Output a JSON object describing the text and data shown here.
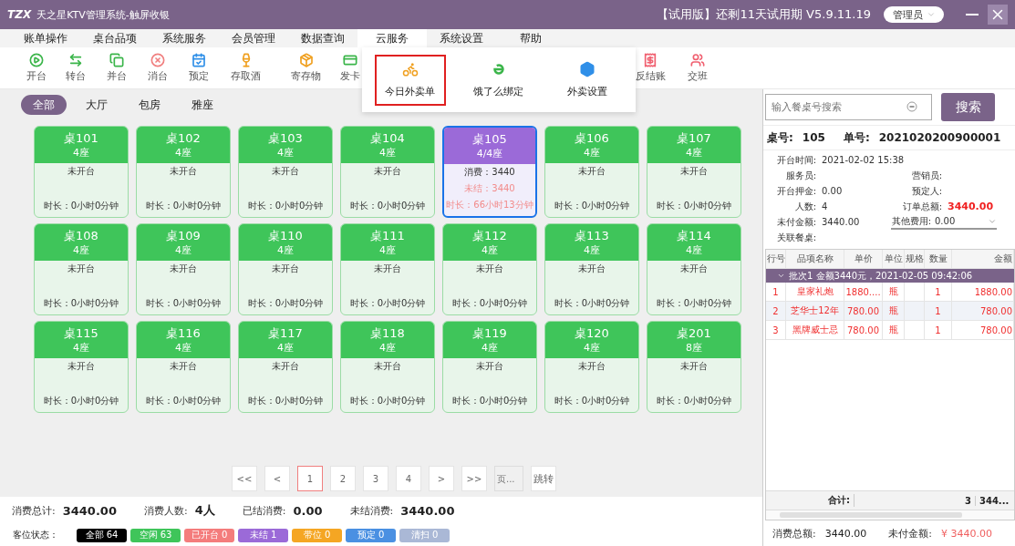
{
  "title_bar": {
    "logo": "TZX",
    "title": "天之星KTV管理系统-触屏收银",
    "trial_info": "【试用版】还剩11天试用期 V5.9.11.19",
    "user": "管理员"
  },
  "menu": [
    {
      "label": "账单操作",
      "selected": false
    },
    {
      "label": "桌台品项",
      "selected": false
    },
    {
      "label": "系统服务",
      "selected": false
    },
    {
      "label": "会员管理",
      "selected": false
    },
    {
      "label": "数据查询",
      "selected": false
    },
    {
      "label": "云服务",
      "selected": true
    },
    {
      "label": "系统设置",
      "selected": false
    },
    {
      "label": "帮助",
      "selected": false
    }
  ],
  "toolbar": [
    {
      "label": "开台",
      "color": "#3bb54a"
    },
    {
      "label": "转台",
      "color": "#3bb54a"
    },
    {
      "label": "并台",
      "color": "#3bb54a"
    },
    {
      "label": "消台",
      "color": "#f07f7f"
    },
    {
      "label": "预定",
      "color": "#2f8fe8"
    },
    {
      "label": "存取酒",
      "color": "#f0a020"
    },
    {
      "label": "寄存物",
      "color": "#f0a020"
    },
    {
      "label": "发卡",
      "color": "#3bb54a"
    },
    {
      "label": "反结账",
      "color": "#f06070"
    },
    {
      "label": "交班",
      "color": "#f06070"
    }
  ],
  "dropdown": [
    {
      "label": "今日外卖单",
      "selected": true
    },
    {
      "label": "饿了么绑定",
      "selected": false
    },
    {
      "label": "外卖设置",
      "selected": false
    }
  ],
  "area_tabs": [
    {
      "label": "全部",
      "selected": true
    },
    {
      "label": "大厅",
      "selected": false
    },
    {
      "label": "包房",
      "selected": false
    },
    {
      "label": "雅座",
      "selected": false
    }
  ],
  "tables": [
    {
      "name": "桌101",
      "seats": "4座",
      "kind": "idle",
      "selected": false,
      "status": "未开台",
      "duration": "时长：0小时0分钟"
    },
    {
      "name": "桌102",
      "seats": "4座",
      "kind": "idle",
      "selected": false,
      "status": "未开台",
      "duration": "时长：0小时0分钟"
    },
    {
      "name": "桌103",
      "seats": "4座",
      "kind": "idle",
      "selected": false,
      "status": "未开台",
      "duration": "时长：0小时0分钟"
    },
    {
      "name": "桌104",
      "seats": "4座",
      "kind": "idle",
      "selected": false,
      "status": "未开台",
      "duration": "时长：0小时0分钟"
    },
    {
      "name": "桌105",
      "seats": "4/4座",
      "kind": "unsettled",
      "selected": true,
      "status": "消费：3440",
      "unsettled": "未结：3440",
      "duration": "时长：66小时13分钟"
    },
    {
      "name": "桌106",
      "seats": "4座",
      "kind": "idle",
      "selected": false,
      "status": "未开台",
      "duration": "时长：0小时0分钟"
    },
    {
      "name": "桌107",
      "seats": "4座",
      "kind": "idle",
      "selected": false,
      "status": "未开台",
      "duration": "时长：0小时0分钟"
    },
    {
      "name": "桌108",
      "seats": "4座",
      "kind": "idle",
      "selected": false,
      "status": "未开台",
      "duration": "时长：0小时0分钟"
    },
    {
      "name": "桌109",
      "seats": "4座",
      "kind": "idle",
      "selected": false,
      "status": "未开台",
      "duration": "时长：0小时0分钟"
    },
    {
      "name": "桌110",
      "seats": "4座",
      "kind": "idle",
      "selected": false,
      "status": "未开台",
      "duration": "时长：0小时0分钟"
    },
    {
      "name": "桌111",
      "seats": "4座",
      "kind": "idle",
      "selected": false,
      "status": "未开台",
      "duration": "时长：0小时0分钟"
    },
    {
      "name": "桌112",
      "seats": "4座",
      "kind": "idle",
      "selected": false,
      "status": "未开台",
      "duration": "时长：0小时0分钟"
    },
    {
      "name": "桌113",
      "seats": "4座",
      "kind": "idle",
      "selected": false,
      "status": "未开台",
      "duration": "时长：0小时0分钟"
    },
    {
      "name": "桌114",
      "seats": "4座",
      "kind": "idle",
      "selected": false,
      "status": "未开台",
      "duration": "时长：0小时0分钟"
    },
    {
      "name": "桌115",
      "seats": "4座",
      "kind": "idle",
      "selected": false,
      "status": "未开台",
      "duration": "时长：0小时0分钟"
    },
    {
      "name": "桌116",
      "seats": "4座",
      "kind": "idle",
      "selected": false,
      "status": "未开台",
      "duration": "时长：0小时0分钟"
    },
    {
      "name": "桌117",
      "seats": "4座",
      "kind": "idle",
      "selected": false,
      "status": "未开台",
      "duration": "时长：0小时0分钟"
    },
    {
      "name": "桌118",
      "seats": "4座",
      "kind": "idle",
      "selected": false,
      "status": "未开台",
      "duration": "时长：0小时0分钟"
    },
    {
      "name": "桌119",
      "seats": "4座",
      "kind": "idle",
      "selected": false,
      "status": "未开台",
      "duration": "时长：0小时0分钟"
    },
    {
      "name": "桌120",
      "seats": "4座",
      "kind": "idle",
      "selected": false,
      "status": "未开台",
      "duration": "时长：0小时0分钟"
    },
    {
      "name": "桌201",
      "seats": "8座",
      "kind": "idle",
      "selected": false,
      "status": "未开台",
      "duration": "时长：0小时0分钟"
    }
  ],
  "pagination": {
    "pages": [
      {
        "label": "<<",
        "selected": false
      },
      {
        "label": "<",
        "selected": false
      },
      {
        "label": "1",
        "selected": true
      },
      {
        "label": "2",
        "selected": false
      },
      {
        "label": "3",
        "selected": false
      },
      {
        "label": "4",
        "selected": false
      },
      {
        "label": ">",
        "selected": false
      },
      {
        "label": ">>",
        "selected": false
      }
    ],
    "page_placeholder": "页...",
    "jump": "跳转"
  },
  "stats": [
    {
      "label": "消费总计:",
      "value": "3440.00"
    },
    {
      "label": "消费人数:",
      "value": "4人"
    },
    {
      "label": "已结消费:",
      "value": "0.00"
    },
    {
      "label": "未结消费:",
      "value": "3440.00"
    }
  ],
  "legend": {
    "label": "客位状态：",
    "chips": [
      {
        "label": "全部 64",
        "color": "#000000"
      },
      {
        "label": "空闲 63",
        "color": "#3fc55a"
      },
      {
        "label": "已开台 0",
        "color": "#f47c7c"
      },
      {
        "label": "未结 1",
        "color": "#9b6ad8"
      },
      {
        "label": "带位 0",
        "color": "#f5a623"
      },
      {
        "label": "预定 0",
        "color": "#4a90e2"
      },
      {
        "label": "清扫 0",
        "color": "#aab8d6"
      }
    ]
  },
  "order": {
    "search_placeholder": "输入餐桌号搜索",
    "search_button": "搜索",
    "table_label": "桌号:",
    "table_no": "105",
    "order_label": "单号:",
    "order_no": "2021020200900001",
    "fields": [
      {
        "label": "开台时间:",
        "value": "2021-02-02 15:38"
      },
      {
        "label": "服务员:"
      },
      {
        "label": "营销员:"
      },
      {
        "label": "开台押金:",
        "value": "0.00"
      },
      {
        "label": "预定人:"
      },
      {
        "label": "人数:",
        "value": "4"
      },
      {
        "label": "订单总额:",
        "value": "3440.00"
      },
      {
        "label": "未付金额:",
        "value": "3440.00"
      },
      {
        "label": "其他费用:",
        "value": "0.00"
      },
      {
        "label": "关联餐桌:"
      }
    ],
    "columns": [
      "行号",
      "品项名称",
      "单价",
      "单位",
      "规格",
      "数量",
      "金额"
    ],
    "batch": "批次1   金额3440元，2021-02-05 09:42:06",
    "rows": [
      [
        "1",
        "皇家礼炮",
        "1880....",
        "瓶",
        "",
        "1",
        "1880.00"
      ],
      [
        "2",
        "芝华士12年",
        "780.00",
        "瓶",
        "",
        "1",
        "780.00"
      ],
      [
        "3",
        "黑牌威士忌",
        "780.00",
        "瓶",
        "",
        "1",
        "780.00"
      ]
    ],
    "total_label": "合计:",
    "total_qty": "3",
    "total_amount": "344...",
    "footer": [
      {
        "label": "消费总额:",
        "value": "3440.00"
      },
      {
        "label": "未付金额:",
        "value": "¥ 3440.00"
      }
    ]
  }
}
